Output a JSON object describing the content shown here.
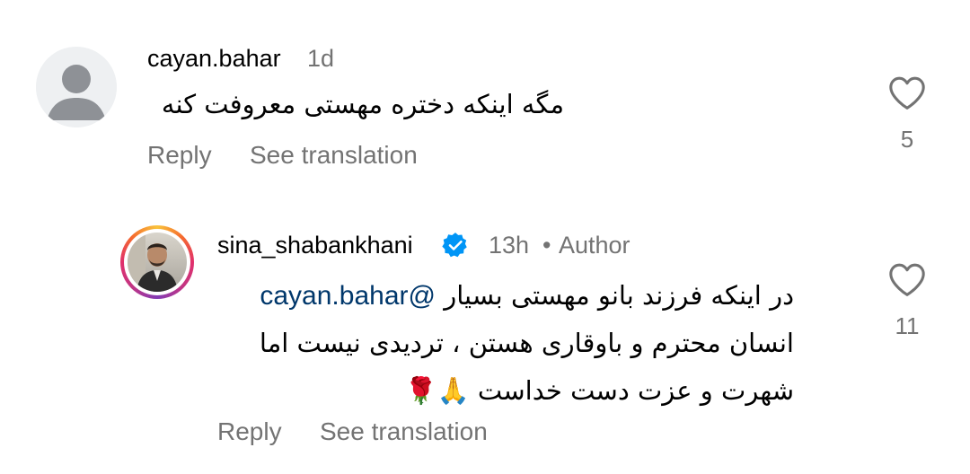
{
  "comments": [
    {
      "username": "cayan.bahar",
      "time": "1d",
      "text": "مگه اینکه دختره مهستی معروفت کنه",
      "reply_label": "Reply",
      "translate_label": "See translation",
      "likes": "5",
      "verified": false
    },
    {
      "username": "sina_shabankhani",
      "time": "13h",
      "separator": "•",
      "author_label": "Author",
      "mention": "@cayan.bahar",
      "text_line1": "در اینکه فرزند بانو مهستی بسیار",
      "text_line2": "انسان محترم و باوقاری هستن ، تردیدی نیست اما",
      "text_line3": "شهرت و عزت دست خداست 🙏🌹",
      "reply_label": "Reply",
      "translate_label": "See translation",
      "likes": "11",
      "verified": true
    }
  ],
  "colors": {
    "secondary_text": "#737373",
    "mention": "#00376b",
    "verified_badge": "#0095f6",
    "heart_stroke": "#737373"
  },
  "icons": {
    "like": "heart-outline-icon",
    "verified": "verified-badge-icon",
    "default_avatar": "default-avatar-icon"
  }
}
